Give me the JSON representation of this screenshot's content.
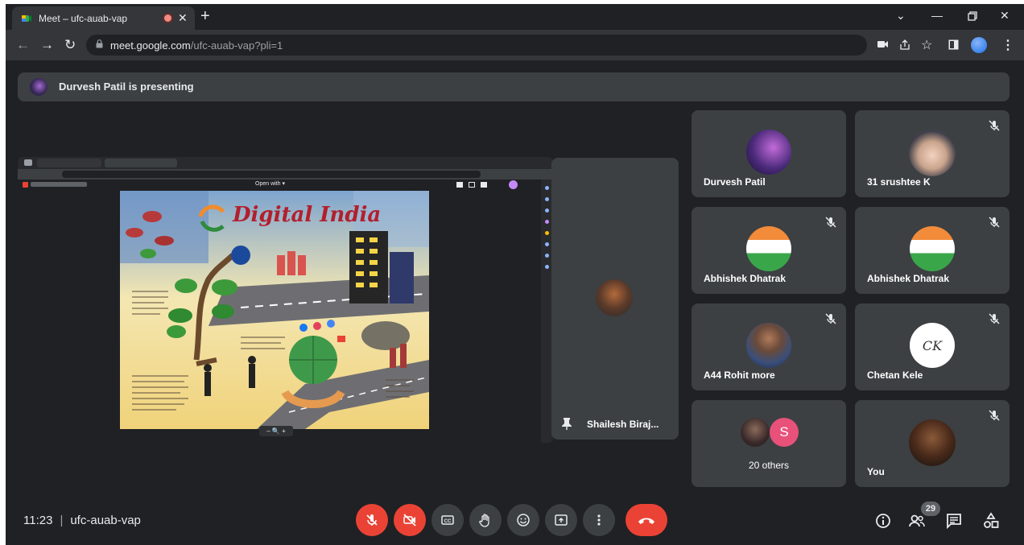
{
  "browser": {
    "tab_title": "Meet – ufc-auab-vap",
    "url_host": "meet.google.com",
    "url_path": "/ufc-auab-vap?pli=1"
  },
  "meet": {
    "presenting_text": "Durvesh Patil is presenting",
    "pinned_tile_name": "Shailesh Biraj...",
    "participants": [
      {
        "name": "Durvesh Patil",
        "muted": false
      },
      {
        "name": "31 srushtee K",
        "muted": true
      },
      {
        "name": "Abhishek Dhatrak",
        "muted": true
      },
      {
        "name": "Abhishek Dhatrak",
        "muted": true
      },
      {
        "name": "A44 Rohit more",
        "muted": true
      },
      {
        "name": "Chetan Kele",
        "muted": true
      },
      {
        "name": "20 others",
        "muted": false
      },
      {
        "name": "You",
        "muted": true
      }
    ],
    "others_initial": "S",
    "chetan_initials": "CK",
    "time": "11:23",
    "meeting_code": "ufc-auab-vap",
    "participant_count": "29"
  },
  "shared_screen": {
    "poster_title": "Digital India",
    "zoom_label": "– 🔍 +",
    "open_with_label": "Open with ▾"
  },
  "colors": {
    "accent_red": "#ea4335",
    "tile_bg": "#3c4043",
    "page_bg": "#202124",
    "others_avatar": "#e8517a"
  }
}
